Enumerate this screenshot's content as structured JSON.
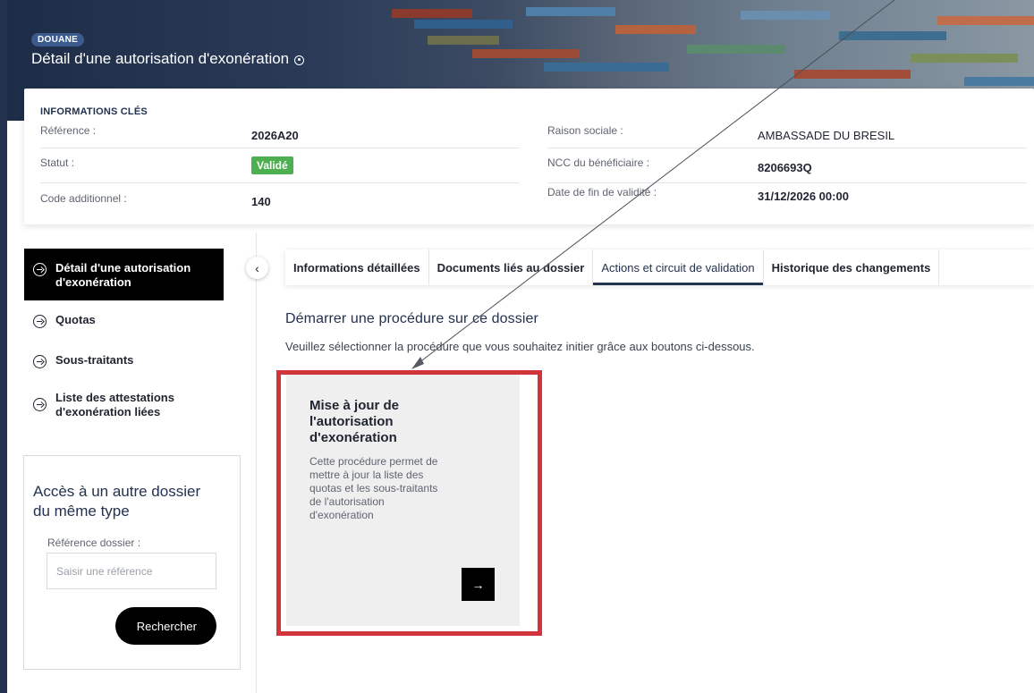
{
  "header": {
    "badge": "DOUANE",
    "title": "Détail d'une autorisation d'exonération"
  },
  "key_info": {
    "title": "INFORMATIONS CLÉS",
    "fields_left": [
      {
        "label": "Référence :",
        "value": "2026A20"
      },
      {
        "label": "Statut :",
        "value": "Validé"
      },
      {
        "label": "Code additionnel :",
        "value": "140"
      }
    ],
    "fields_right": [
      {
        "label": "Raison sociale :",
        "value": "AMBASSADE DU BRESIL"
      },
      {
        "label": "NCC du bénéficiaire :",
        "value": "8206693Q"
      },
      {
        "label": "Date de fin de validité :",
        "value": "31/12/2026 00:00"
      }
    ],
    "status_color": "#4caf50"
  },
  "sidebar": {
    "items": [
      {
        "label_line1": "Détail d'une autorisation",
        "label_line2": "d'exonération",
        "active": true
      },
      {
        "label_line1": "Quotas",
        "label_line2": "",
        "active": false
      },
      {
        "label_line1": "Sous-traitants",
        "label_line2": "",
        "active": false
      },
      {
        "label_line1": "Liste des attestations",
        "label_line2": "d'exonération liées",
        "active": false
      }
    ],
    "access": {
      "title": "Accès à un autre dossier du même type",
      "ref_label": "Référence dossier :",
      "ref_placeholder": "Saisir une référence",
      "search_label": "Rechercher"
    }
  },
  "tabs": [
    {
      "label": "Informations détaillées",
      "active": false
    },
    {
      "label": "Documents liés au dossier",
      "active": false
    },
    {
      "label": "Actions et circuit de validation",
      "active": true
    },
    {
      "label": "Historique des changements",
      "active": false
    }
  ],
  "main": {
    "title": "Démarrer une procédure sur ce dossier",
    "subtitle": "Veuillez sélectionner la procédure que vous souhaitez initier grâce aux boutons ci-dessous.",
    "procedure": {
      "title_lines": [
        "Mise à jour de",
        "l'autorisation",
        "d'exonération"
      ],
      "desc_lines": [
        "Cette procédure permet de",
        "mettre à jour la liste des",
        "quotas et les sous-traitants",
        "de l'autorisation",
        "d'exonération"
      ],
      "arrow_icon": "arrow-right-icon"
    }
  },
  "colors": {
    "accent_dark": "#23324e",
    "highlight_red": "#d1343b",
    "black": "#000000"
  }
}
